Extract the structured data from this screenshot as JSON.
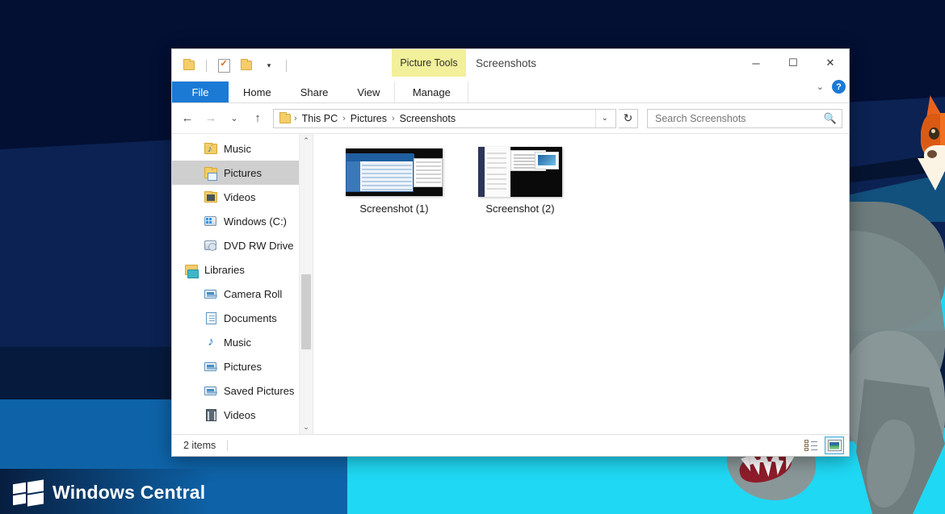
{
  "desktop": {
    "watermark": "Windows Central",
    "wallpaper_colors": {
      "navy_dark": "#030f33",
      "navy": "#0b2252",
      "blue": "#0e63a8",
      "cyan": "#1fd8f4",
      "creature_grey": "#7b8a8b",
      "fox_orange": "#f0701f"
    }
  },
  "window": {
    "title": "Screenshots",
    "contextual_tab_group": "Picture Tools",
    "quick_access": [
      {
        "name": "folder-icon",
        "label": ""
      },
      {
        "name": "properties-icon",
        "label": ""
      },
      {
        "name": "new-folder-icon",
        "label": ""
      },
      {
        "name": "customize-caret",
        "label": "▾"
      }
    ],
    "controls": {
      "minimize": "─",
      "maximize": "☐",
      "close": "✕",
      "ribbon_expand": "⌄",
      "help": "?"
    },
    "tabs": [
      {
        "label": "File",
        "id": "file",
        "selected": false,
        "accent": "#1a7ad4"
      },
      {
        "label": "Home",
        "id": "home",
        "selected": false
      },
      {
        "label": "Share",
        "id": "share",
        "selected": false
      },
      {
        "label": "View",
        "id": "view",
        "selected": false
      },
      {
        "label": "Manage",
        "id": "manage",
        "selected": true
      }
    ]
  },
  "addressbar": {
    "back": "←",
    "forward": "→",
    "recent": "⌄",
    "up": "↑",
    "breadcrumb": [
      "This PC",
      "Pictures",
      "Screenshots"
    ],
    "separator": "›",
    "dropdown": "⌄",
    "refresh": "↻"
  },
  "search": {
    "placeholder": "Search Screenshots",
    "value": "",
    "icon": "search-icon"
  },
  "navpane": {
    "items": [
      {
        "label": "Music",
        "icon": "folder-music-icon",
        "level": 1,
        "selected": false
      },
      {
        "label": "Pictures",
        "icon": "folder-pictures-icon",
        "level": 1,
        "selected": true
      },
      {
        "label": "Videos",
        "icon": "folder-videos-icon",
        "level": 1,
        "selected": false
      },
      {
        "label": "Windows (C:)",
        "icon": "drive-windows-icon",
        "level": 1,
        "selected": false
      },
      {
        "label": "DVD RW Drive",
        "icon": "dvd-drive-icon",
        "level": 1,
        "selected": false
      },
      {
        "label": "Libraries",
        "icon": "libraries-icon",
        "level": 0,
        "selected": false
      },
      {
        "label": "Camera Roll",
        "icon": "library-pictures-icon",
        "level": 2,
        "selected": false
      },
      {
        "label": "Documents",
        "icon": "library-documents-icon",
        "level": 2,
        "selected": false
      },
      {
        "label": "Music",
        "icon": "library-music-icon",
        "level": 2,
        "selected": false
      },
      {
        "label": "Pictures",
        "icon": "library-pictures-icon",
        "level": 2,
        "selected": false
      },
      {
        "label": "Saved Pictures",
        "icon": "library-pictures-icon",
        "level": 2,
        "selected": false
      },
      {
        "label": "Videos",
        "icon": "library-videos-icon",
        "level": 2,
        "selected": false
      }
    ],
    "scroll_up": "⌃",
    "scroll_down": "⌄"
  },
  "files": [
    {
      "name": "Screenshot (1)",
      "thumbnail": "screenshot-thumbnail-1"
    },
    {
      "name": "Screenshot (2)",
      "thumbnail": "screenshot-thumbnail-2"
    }
  ],
  "statusbar": {
    "item_count": "2 items",
    "views": [
      {
        "name": "details-view-button",
        "active": false
      },
      {
        "name": "large-icons-view-button",
        "active": true
      }
    ]
  }
}
